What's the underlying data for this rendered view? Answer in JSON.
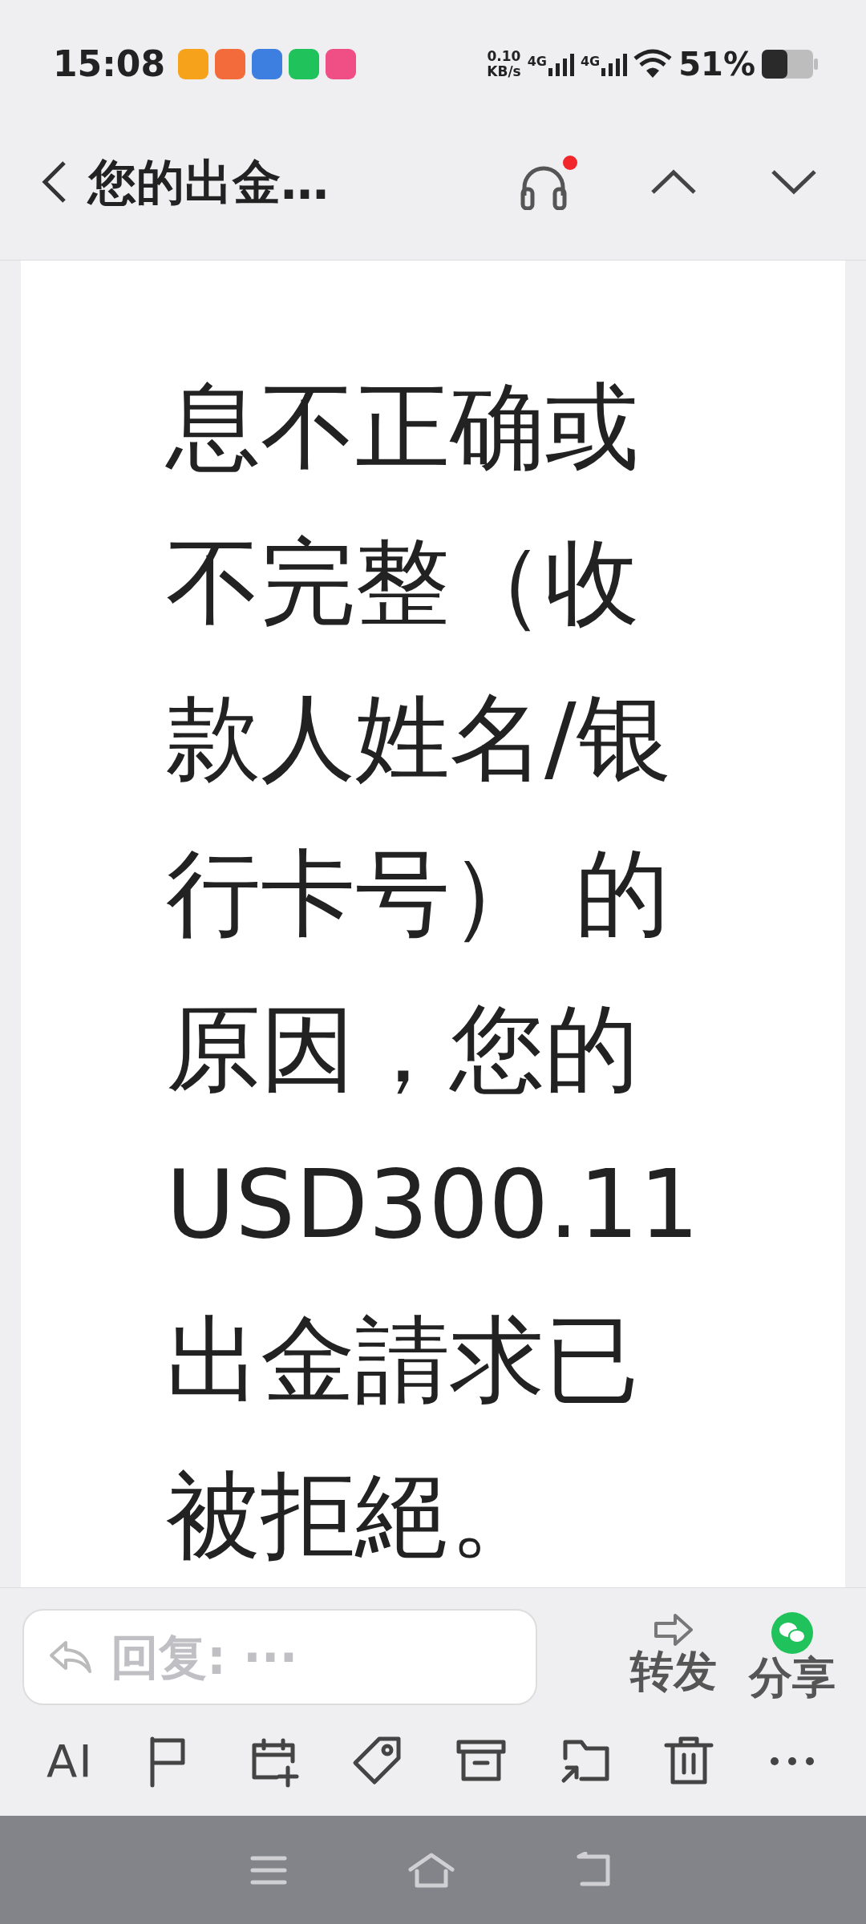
{
  "status_bar": {
    "time": "15:08",
    "notification_apps": [
      {
        "color": "#f7a21b"
      },
      {
        "color": "#f36b3a"
      },
      {
        "color": "#3d7fe0"
      },
      {
        "color": "#1fc25b"
      },
      {
        "color": "#f04f86"
      }
    ],
    "speed_value": "0.10",
    "speed_unit": "KB/s",
    "networks": [
      "4G",
      "4G"
    ],
    "battery": "51%"
  },
  "header": {
    "title": "您的出金…",
    "audio_unread": true
  },
  "message": {
    "lines": [
      "息不正确或",
      "不完整（收",
      "款人姓名/银",
      "行卡号） 的",
      "原因，您的",
      "USD300.11",
      "出金請求已",
      "被拒絕。"
    ]
  },
  "reply": {
    "placeholder": "回复: ···"
  },
  "actions": [
    {
      "kind": "forward",
      "label": "转发"
    },
    {
      "kind": "share",
      "label": "分享"
    }
  ],
  "toolbar": [
    {
      "kind": "ai",
      "label": "AI"
    },
    {
      "kind": "flag"
    },
    {
      "kind": "calendar"
    },
    {
      "kind": "tag"
    },
    {
      "kind": "archive"
    },
    {
      "kind": "move"
    },
    {
      "kind": "delete"
    },
    {
      "kind": "more"
    }
  ]
}
